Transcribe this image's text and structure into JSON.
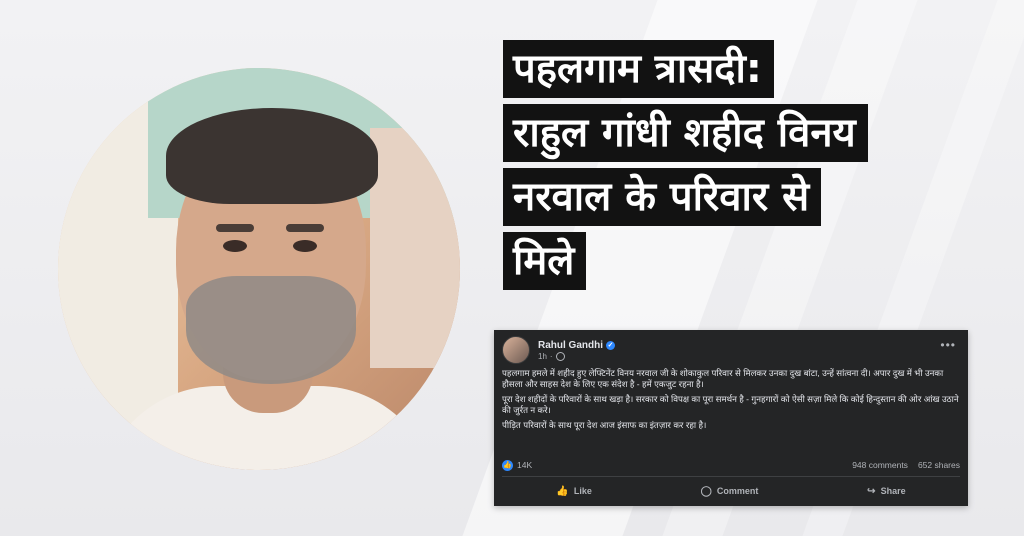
{
  "headline": {
    "lines": [
      "पहलगाम त्रासदी:",
      "राहुल गांधी शहीद विनय",
      "नरवाल के परिवार से",
      "मिले"
    ]
  },
  "post": {
    "author": "Rahul Gandhi",
    "time": "1h",
    "paragraphs": [
      "पहलगाम हमले में शहीद हुए लेफ्टिनेंट विनय नरवाल जी के शोकाकुल परिवार से मिलकर उनका दुख बांटा, उन्हें सांत्वना दी। अपार दुख में भी उनका हौसला और साहस देश के लिए एक संदेश है - हमें एकजुट रहना है।",
      "पूरा देश शहीदों के परिवारों के साथ खड़ा है। सरकार को विपक्ष का पूरा समर्थन है - गुनहगारों को ऐसी सज़ा मिले कि कोई हिन्दुस्तान की ओर आंख उठाने की जुर्रत न करे।",
      "पीड़ित परिवारों के साथ पूरा देश आज इंसाफ का इंतज़ार कर रहा है।"
    ],
    "likes": "14K",
    "comments": "948 comments",
    "shares": "652 shares",
    "actions": {
      "like": "Like",
      "comment": "Comment",
      "share": "Share"
    }
  }
}
